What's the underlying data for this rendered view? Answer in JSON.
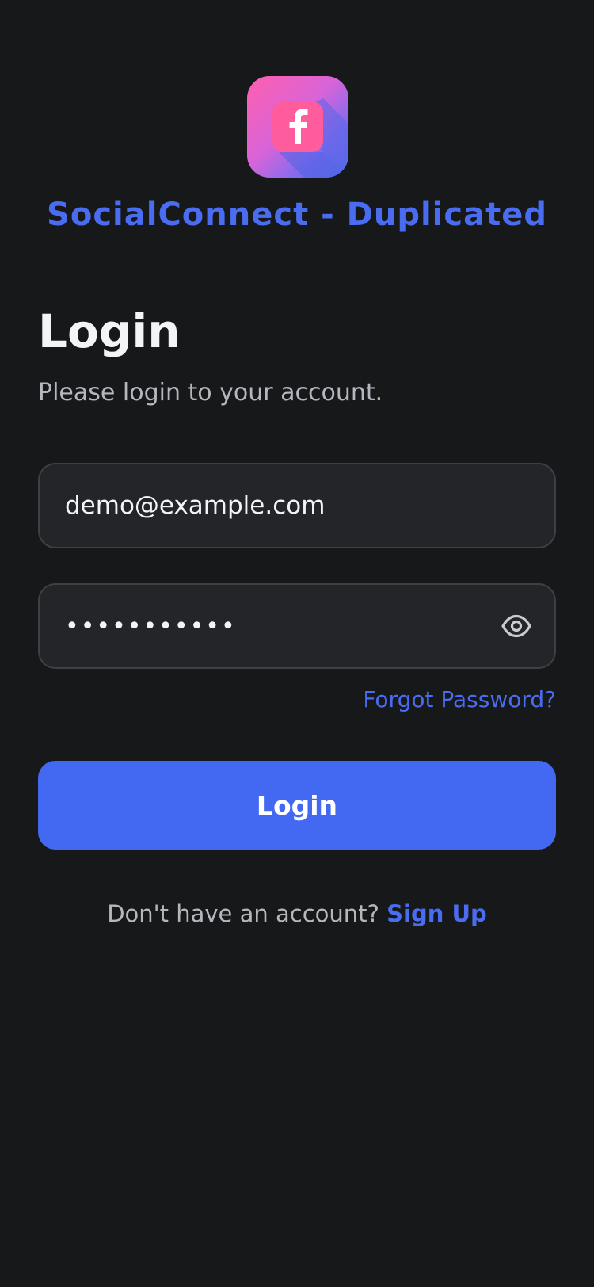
{
  "app": {
    "name": "SocialConnect - Duplicated",
    "icon": "facebook-f-icon",
    "icon_colors": [
      "#ff5fae",
      "#7d6cf0",
      "#4d6de8"
    ]
  },
  "header": {
    "title": "Login",
    "subtitle": "Please login to your account."
  },
  "form": {
    "email_value": "demo@example.com",
    "password_value": "•••••••••••",
    "password_toggle_icon": "eye-icon",
    "forgot_label": "Forgot Password?",
    "submit_label": "Login"
  },
  "footer": {
    "prompt": "Don't have an account?",
    "signup_label": "Sign Up"
  },
  "colors": {
    "background": "#17181a",
    "accent": "#4368f2",
    "link": "#4a6cf0",
    "field_background": "#232528"
  }
}
